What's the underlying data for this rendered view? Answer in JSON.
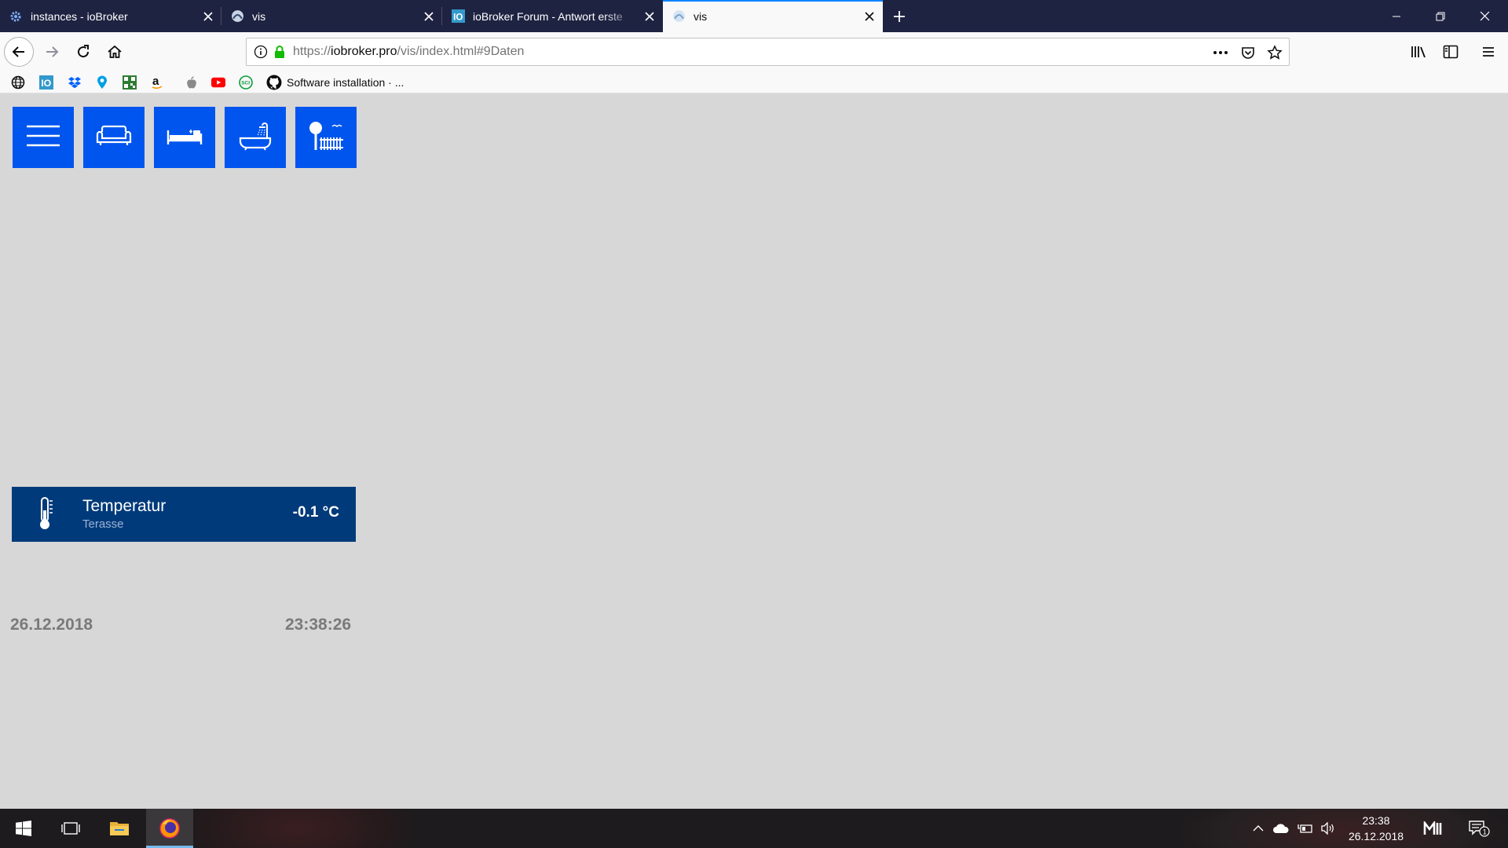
{
  "browser": {
    "tabs": [
      {
        "title": "instances - ioBroker",
        "favicon": "gear-icon"
      },
      {
        "title": "vis",
        "favicon": "vis-icon"
      },
      {
        "title": "ioBroker Forum - Antwort erste",
        "favicon": "iobroker-icon"
      },
      {
        "title": "vis",
        "favicon": "vis-icon",
        "active": true
      }
    ],
    "url": {
      "scheme": "https://",
      "host": "iobroker.pro",
      "path": "/vis/index.html#9Daten"
    },
    "bookmarks": {
      "text_item": "Software installation · ..."
    }
  },
  "vis": {
    "tiles": [
      {
        "name": "menu-icon"
      },
      {
        "name": "sofa-icon"
      },
      {
        "name": "bed-icon"
      },
      {
        "name": "bathtub-icon"
      },
      {
        "name": "garden-icon"
      }
    ],
    "temperature": {
      "title": "Temperatur",
      "subtitle": "Terasse",
      "value": "-0.1 °C"
    },
    "date": "26.12.2018",
    "time": "23:38:26"
  },
  "taskbar": {
    "clock_time": "23:38",
    "clock_date": "26.12.2018",
    "notification_count": "1"
  },
  "colors": {
    "page_background": "#d7d7d7",
    "tile_blue": "#0055ee",
    "widget_navy": "#003a7a",
    "tab_strip": "#1f2342"
  }
}
